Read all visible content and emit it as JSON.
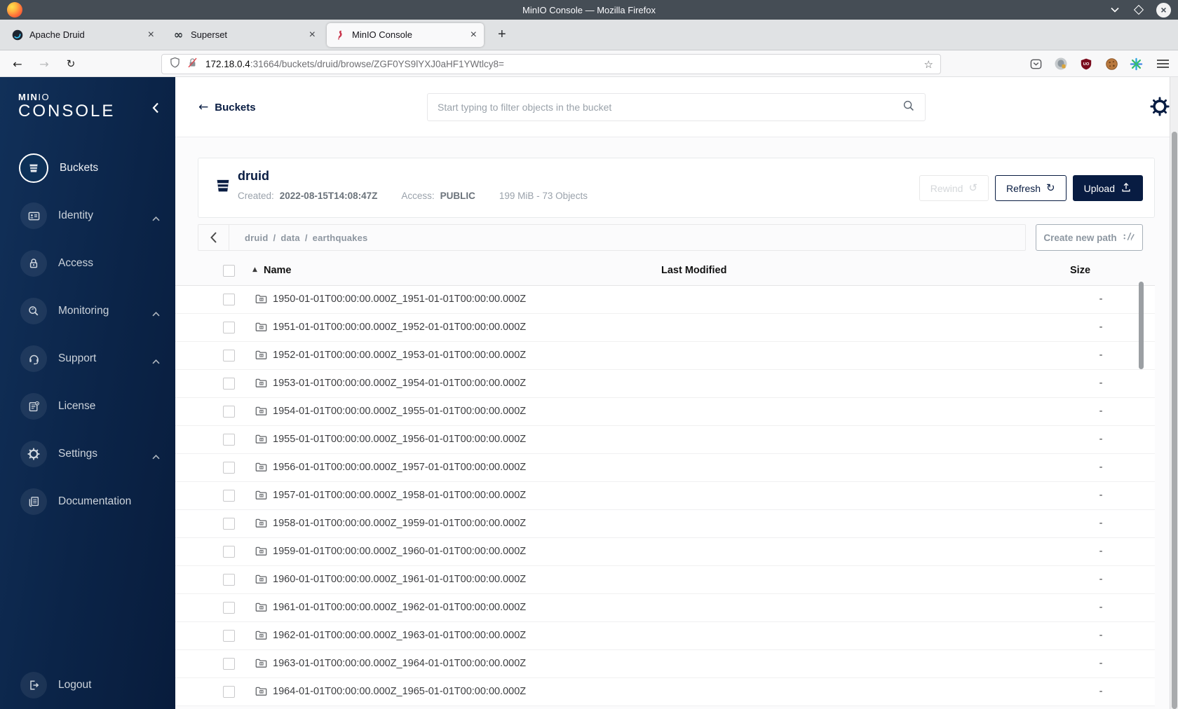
{
  "browser": {
    "title": "MinIO Console — Mozilla Firefox",
    "tabs": [
      {
        "label": "Apache Druid",
        "icon": "druid-icon",
        "active": false
      },
      {
        "label": "Superset",
        "icon": "superset-icon",
        "active": false
      },
      {
        "label": "MinIO Console",
        "icon": "minio-flamingo-icon",
        "active": true
      }
    ],
    "url": {
      "host": "172.18.0.4",
      "rest": ":31664/buckets/druid/browse/ZGF0YS9lYXJ0aHF1YWtlcy8="
    }
  },
  "sidebar": {
    "logo_bold": "MIN",
    "logo_light": "IO",
    "logo_line2": "CONSOLE",
    "items": [
      {
        "label": "Buckets",
        "icon": "bucket-icon",
        "active": true,
        "expandable": false
      },
      {
        "label": "Identity",
        "icon": "identity-card-icon",
        "active": false,
        "expandable": true
      },
      {
        "label": "Access",
        "icon": "lock-icon",
        "active": false,
        "expandable": false
      },
      {
        "label": "Monitoring",
        "icon": "magnifier-icon",
        "active": false,
        "expandable": true
      },
      {
        "label": "Support",
        "icon": "headset-icon",
        "active": false,
        "expandable": true
      },
      {
        "label": "License",
        "icon": "license-doc-icon",
        "active": false,
        "expandable": false
      },
      {
        "label": "Settings",
        "icon": "gear-icon",
        "active": false,
        "expandable": true
      },
      {
        "label": "Documentation",
        "icon": "book-icon",
        "active": false,
        "expandable": false
      }
    ],
    "logout_label": "Logout"
  },
  "header": {
    "back_label": "Buckets",
    "search_placeholder": "Start typing to filter objects in the bucket"
  },
  "bucket": {
    "name": "druid",
    "created_label": "Created:",
    "created_value": "2022-08-15T14:08:47Z",
    "access_label": "Access:",
    "access_value": "PUBLIC",
    "stats": "199 MiB - 73 Objects"
  },
  "actions": {
    "rewind": "Rewind",
    "refresh": "Refresh",
    "upload": "Upload",
    "create_path": "Create new path"
  },
  "browse": {
    "breadcrumb": [
      "druid",
      "data",
      "earthquakes"
    ]
  },
  "table": {
    "columns": {
      "name": "Name",
      "last_modified": "Last Modified",
      "size": "Size"
    },
    "sort": "ascending",
    "rows": [
      {
        "name": "1950-01-01T00:00:00.000Z_1951-01-01T00:00:00.000Z",
        "size": "-"
      },
      {
        "name": "1951-01-01T00:00:00.000Z_1952-01-01T00:00:00.000Z",
        "size": "-"
      },
      {
        "name": "1952-01-01T00:00:00.000Z_1953-01-01T00:00:00.000Z",
        "size": "-"
      },
      {
        "name": "1953-01-01T00:00:00.000Z_1954-01-01T00:00:00.000Z",
        "size": "-"
      },
      {
        "name": "1954-01-01T00:00:00.000Z_1955-01-01T00:00:00.000Z",
        "size": "-"
      },
      {
        "name": "1955-01-01T00:00:00.000Z_1956-01-01T00:00:00.000Z",
        "size": "-"
      },
      {
        "name": "1956-01-01T00:00:00.000Z_1957-01-01T00:00:00.000Z",
        "size": "-"
      },
      {
        "name": "1957-01-01T00:00:00.000Z_1958-01-01T00:00:00.000Z",
        "size": "-"
      },
      {
        "name": "1958-01-01T00:00:00.000Z_1959-01-01T00:00:00.000Z",
        "size": "-"
      },
      {
        "name": "1959-01-01T00:00:00.000Z_1960-01-01T00:00:00.000Z",
        "size": "-"
      },
      {
        "name": "1960-01-01T00:00:00.000Z_1961-01-01T00:00:00.000Z",
        "size": "-"
      },
      {
        "name": "1961-01-01T00:00:00.000Z_1962-01-01T00:00:00.000Z",
        "size": "-"
      },
      {
        "name": "1962-01-01T00:00:00.000Z_1963-01-01T00:00:00.000Z",
        "size": "-"
      },
      {
        "name": "1963-01-01T00:00:00.000Z_1964-01-01T00:00:00.000Z",
        "size": "-"
      },
      {
        "name": "1964-01-01T00:00:00.000Z_1965-01-01T00:00:00.000Z",
        "size": "-"
      }
    ]
  },
  "colors": {
    "accent_navy": "#081C42",
    "minio_red": "#C9354C",
    "titlebar": "#454d55",
    "sidebar_gradient_start": "#113059",
    "sidebar_gradient_end": "#081c3c"
  }
}
